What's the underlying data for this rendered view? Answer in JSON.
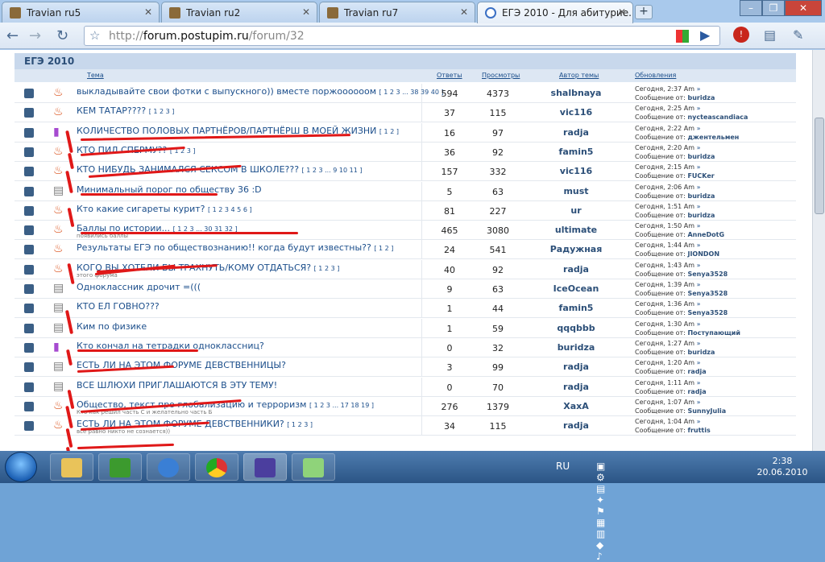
{
  "tabs": [
    {
      "title": "Travian ru5",
      "icon": "travian-icon"
    },
    {
      "title": "Travian ru2",
      "icon": "travian-icon"
    },
    {
      "title": "Travian ru7",
      "icon": "travian-icon"
    },
    {
      "title": "ЕГЭ 2010 - Для абитурие...",
      "icon": "postupim-icon"
    }
  ],
  "toolbar": {
    "url_prefix": "http://",
    "url_host": "forum.postupim.ru",
    "url_path": "/forum/32"
  },
  "forum": {
    "header": "ЕГЭ 2010",
    "columns": {
      "topic": "Тема",
      "replies": "Ответы",
      "views": "Просмотры",
      "author": "Автор темы",
      "updates": "Обновления"
    }
  },
  "rows": [
    {
      "icon": "hot",
      "title": "выкладывайте свои фотки с выпускного)) вместе поржоооооом",
      "pages": "[ 1 2 3 ... 38 39 40 ]",
      "sub": "",
      "replies": "594",
      "views": "4373",
      "author": "shalbnaya",
      "date": "Сегодня, 2:37 Am",
      "last_by": "buridza"
    },
    {
      "icon": "hot",
      "title": "КЕМ ТАТАР????",
      "pages": "[ 1 2 3 ]",
      "sub": "",
      "replies": "37",
      "views": "115",
      "author": "vic116",
      "date": "Сегодня, 2:25 Am",
      "last_by": "nycteascandiaca"
    },
    {
      "icon": "poll",
      "title": "КОЛИЧЕСТВО ПОЛОВЫХ ПАРТНЁРОВ/ПАРТНЁРШ В МОЕЙ ЖИЗНИ",
      "pages": "[ 1 2 ]",
      "sub": "",
      "replies": "16",
      "views": "97",
      "author": "radja",
      "date": "Сегодня, 2:22 Am",
      "last_by": "джентельмен"
    },
    {
      "icon": "hot",
      "title": "КТО ПИЛ СПЕРМУ??",
      "pages": "[ 1 2 3 ]",
      "sub": "",
      "replies": "36",
      "views": "92",
      "author": "famin5",
      "date": "Сегодня, 2:20 Am",
      "last_by": "buridza"
    },
    {
      "icon": "hot",
      "title": "КТО НИБУДЬ ЗАНИМАЛСЯ СЕКСОМ В ШКОЛЕ???",
      "pages": "[ 1 2 3 ... 9 10 11 ]",
      "sub": "",
      "replies": "157",
      "views": "332",
      "author": "vic116",
      "date": "Сегодня, 2:15 Am",
      "last_by": "FUCKer"
    },
    {
      "icon": "doc",
      "title": "Минимальный порог по обществу 36 :D",
      "pages": "",
      "sub": "",
      "replies": "5",
      "views": "63",
      "author": "must",
      "date": "Сегодня, 2:06 Am",
      "last_by": "buridza"
    },
    {
      "icon": "hot",
      "title": "Кто какие сигареты курит?",
      "pages": "[ 1 2 3 4 5 6 ]",
      "sub": "",
      "replies": "81",
      "views": "227",
      "author": "ur",
      "date": "Сегодня, 1:51 Am",
      "last_by": "buridza"
    },
    {
      "icon": "hot",
      "title": "Баллы по истории...",
      "pages": "[ 1 2 3 ... 30 31 32 ]",
      "sub": "появились баллы",
      "replies": "465",
      "views": "3080",
      "author": "ultimate",
      "date": "Сегодня, 1:50 Am",
      "last_by": "AnneDotG"
    },
    {
      "icon": "hot",
      "title": "Результаты ЕГЭ по обществознанию!! когда будут известны??",
      "pages": "[ 1 2 ]",
      "sub": "",
      "replies": "24",
      "views": "541",
      "author": "Радужная",
      "date": "Сегодня, 1:44 Am",
      "last_by": "JIONDON"
    },
    {
      "icon": "hot",
      "title": "КОГО ВЫ ХОТЕЛИ БЫ ТРАХНУТЬ/КОМУ ОТДАТЬСЯ?",
      "pages": "[ 1 2 3 ]",
      "sub": "этого форума",
      "replies": "40",
      "views": "92",
      "author": "radja",
      "date": "Сегодня, 1:43 Am",
      "last_by": "Senya3528"
    },
    {
      "icon": "doc",
      "title": "Одноклассник дрочит =(((",
      "pages": "",
      "sub": "",
      "replies": "9",
      "views": "63",
      "author": "IceOcean",
      "date": "Сегодня, 1:39 Am",
      "last_by": "Senya3528"
    },
    {
      "icon": "doc",
      "title": "КТО ЕЛ ГОВНО???",
      "pages": "",
      "sub": "",
      "replies": "1",
      "views": "44",
      "author": "famin5",
      "date": "Сегодня, 1:36 Am",
      "last_by": "Senya3528"
    },
    {
      "icon": "doc",
      "title": "Ким по физике",
      "pages": "",
      "sub": "",
      "replies": "1",
      "views": "59",
      "author": "qqqbbb",
      "date": "Сегодня, 1:30 Am",
      "last_by": "Поступающий"
    },
    {
      "icon": "poll",
      "title": "Кто кончал на тетрадки одноклассниц?",
      "pages": "",
      "sub": "",
      "replies": "0",
      "views": "32",
      "author": "buridza",
      "date": "Сегодня, 1:27 Am",
      "last_by": "buridza"
    },
    {
      "icon": "doc",
      "title": "ЕСТЬ ЛИ НА ЭТОМ ФОРУМЕ ДЕВСТВЕННИЦЫ?",
      "pages": "",
      "sub": "",
      "replies": "3",
      "views": "99",
      "author": "radja",
      "date": "Сегодня, 1:20 Am",
      "last_by": "radja"
    },
    {
      "icon": "doc",
      "title": "ВСЕ ШЛЮХИ ПРИГЛАШАЮТСЯ В ЭТУ ТЕМУ!",
      "pages": "",
      "sub": "",
      "replies": "0",
      "views": "70",
      "author": "radja",
      "date": "Сегодня, 1:11 Am",
      "last_by": "radja"
    },
    {
      "icon": "hot",
      "title": "Общество, текст про глобализацию и терроризм",
      "pages": "[ 1 2 3 ... 17 18 19 ]",
      "sub": "Кто как решил часть С и желательно часть Б",
      "replies": "276",
      "views": "1379",
      "author": "XaxA",
      "date": "Сегодня, 1:07 Am",
      "last_by": "SunnyJulia"
    },
    {
      "icon": "hot",
      "title": "ЕСТЬ ЛИ НА ЭТОМ ФОРУМЕ ДЕВСТВЕННИКИ?",
      "pages": "[ 1 2 3 ]",
      "sub": "всё равно никто не сознается))",
      "replies": "34",
      "views": "115",
      "author": "radja",
      "date": "Сегодня, 1:04 Am",
      "last_by": "fruttis"
    }
  ],
  "labels": {
    "last_by_prefix": "Сообщение от:"
  },
  "taskbar": {
    "apps": [
      "explorer-icon",
      "utorrent-icon",
      "ie-icon",
      "chrome-icon",
      "notepad-icon",
      "winamp-icon"
    ],
    "language": "RU",
    "time": "2:38",
    "date": "20.06.2010"
  }
}
